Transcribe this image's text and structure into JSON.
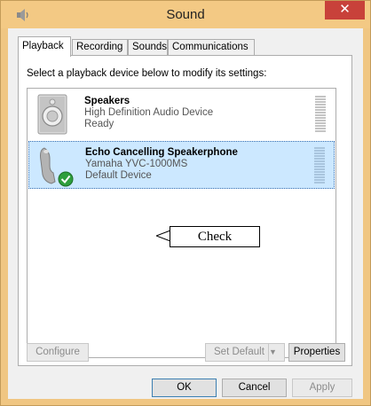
{
  "window": {
    "title": "Sound",
    "close_label": "✕"
  },
  "tabs": [
    {
      "label": "Playback",
      "active": true
    },
    {
      "label": "Recording",
      "active": false
    },
    {
      "label": "Sounds",
      "active": false
    },
    {
      "label": "Communications",
      "active": false
    }
  ],
  "instruction": "Select a playback device below to modify its settings:",
  "devices": [
    {
      "name": "Speakers",
      "description": "High Definition Audio Device",
      "status": "Ready",
      "icon": "speaker-icon",
      "selected": false
    },
    {
      "name": "Echo Cancelling Speakerphone",
      "description": "Yamaha YVC-1000MS",
      "status": "Default Device",
      "icon": "speakerphone-icon",
      "selected": true
    }
  ],
  "callout": {
    "text": "Check"
  },
  "buttons": {
    "configure": "Configure",
    "set_default": "Set Default",
    "properties": "Properties",
    "ok": "OK",
    "cancel": "Cancel",
    "apply": "Apply"
  },
  "colors": {
    "frame": "#f3c984",
    "close": "#c8413a",
    "selection": "#cce8ff",
    "check": "#2e9e3c"
  }
}
